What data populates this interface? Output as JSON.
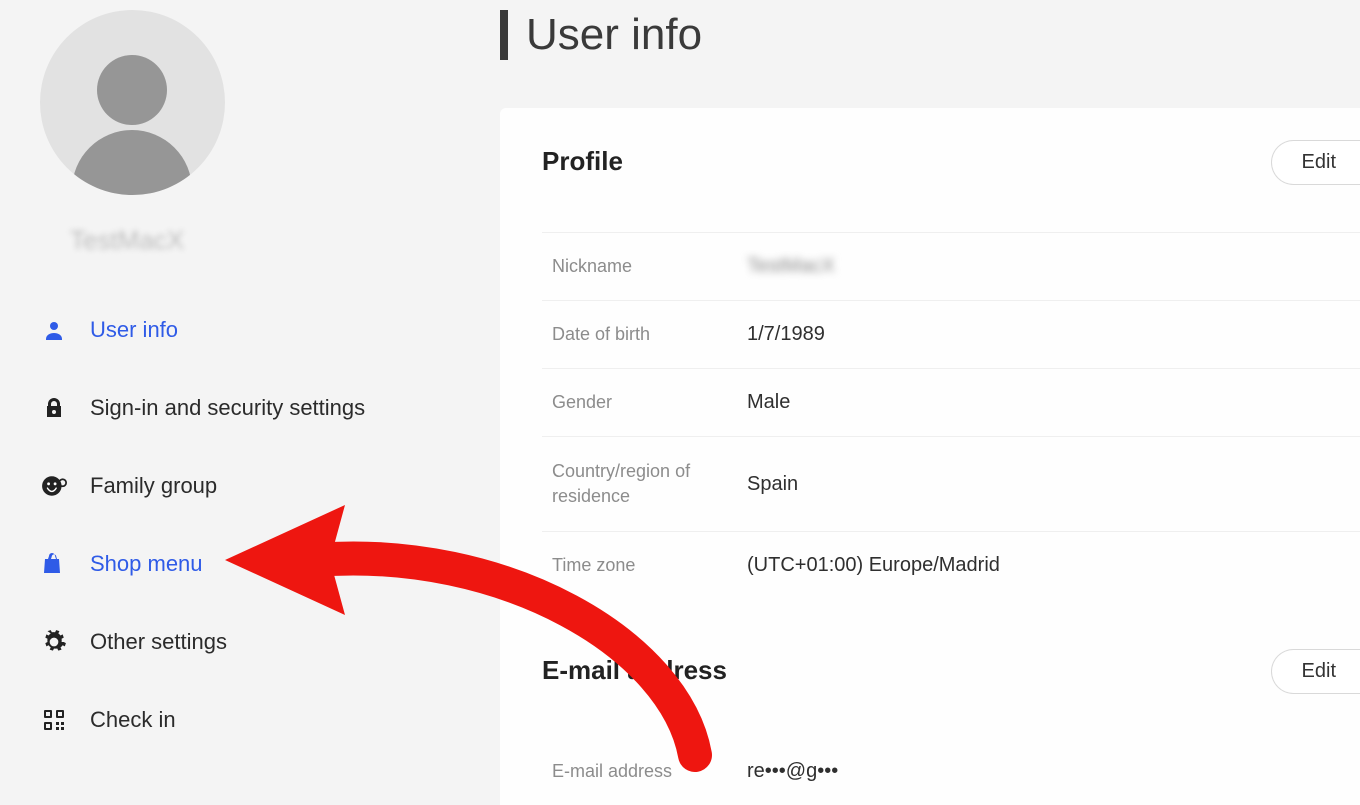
{
  "sidebar": {
    "username": "TestMacX",
    "nav": [
      {
        "label": "User info"
      },
      {
        "label": "Sign-in and security settings"
      },
      {
        "label": "Family group"
      },
      {
        "label": "Shop menu"
      },
      {
        "label": "Other settings"
      },
      {
        "label": "Check in"
      }
    ]
  },
  "page": {
    "title": "User info"
  },
  "profile": {
    "section_title": "Profile",
    "edit_label": "Edit",
    "fields": {
      "nickname_label": "Nickname",
      "nickname_value": "TestMacX",
      "dob_label": "Date of birth",
      "dob_value": "1/7/1989",
      "gender_label": "Gender",
      "gender_value": "Male",
      "country_label": "Country/region of residence",
      "country_value": "Spain",
      "timezone_label": "Time zone",
      "timezone_value": "(UTC+01:00) Europe/Madrid"
    }
  },
  "email": {
    "section_title": "E-mail address",
    "edit_label": "Edit",
    "label": "E-mail address",
    "value": "re•••@g•••"
  }
}
